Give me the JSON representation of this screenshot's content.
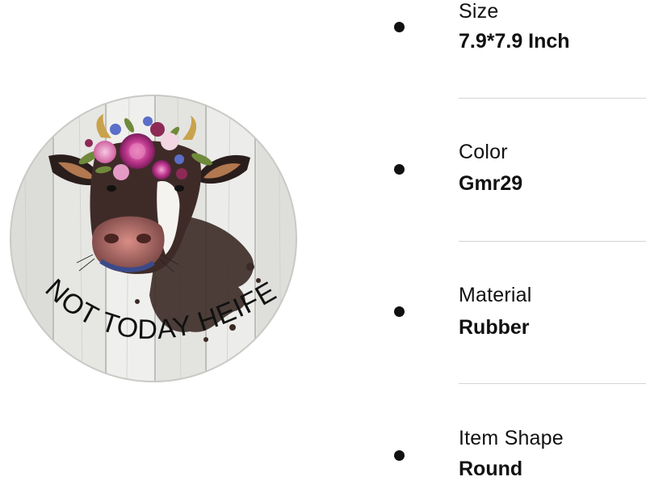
{
  "product": {
    "caption": "NOT TODAY HEIFER",
    "image_icon": "cow-with-flower-crown-icon"
  },
  "specs": [
    {
      "label": "Size",
      "value": "7.9*7.9 Inch"
    },
    {
      "label": "Color",
      "value": "Gmr29"
    },
    {
      "label": "Material",
      "value": "Rubber"
    },
    {
      "label": "Item Shape",
      "value": "Round"
    }
  ]
}
